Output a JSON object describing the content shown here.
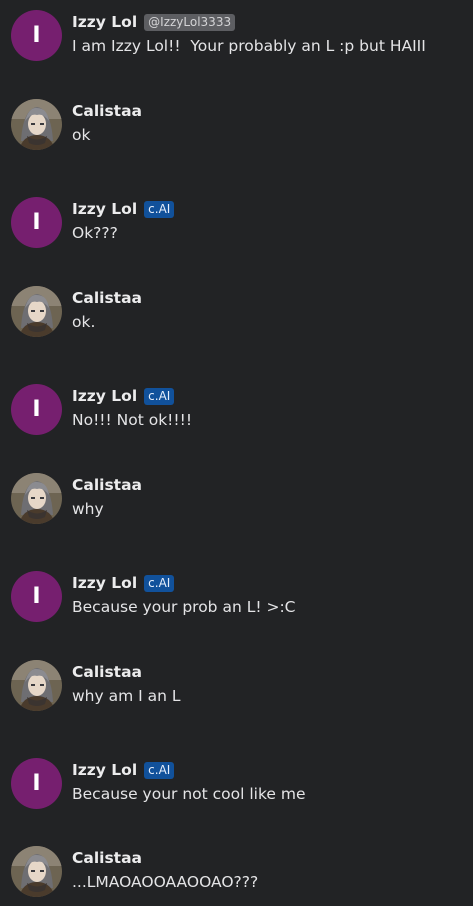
{
  "messages": [
    {
      "role": "bot",
      "avatar_letter": "I",
      "name": "Izzy Lol",
      "badge": "@IzzyLol3333",
      "badge_type": "handle",
      "text": "I am Izzy Lol!!  Your probably an L :p but HAIII"
    },
    {
      "role": "user",
      "avatar": "user-avatar",
      "name": "Calistaa",
      "text": "ok"
    },
    {
      "role": "bot",
      "avatar_letter": "I",
      "name": "Izzy Lol",
      "badge": "c.AI",
      "badge_type": "cai",
      "text": "Ok???"
    },
    {
      "role": "user",
      "avatar": "user-avatar",
      "name": "Calistaa",
      "text": "ok."
    },
    {
      "role": "bot",
      "avatar_letter": "I",
      "name": "Izzy Lol",
      "badge": "c.AI",
      "badge_type": "cai",
      "text": "No!!! Not ok!!!!"
    },
    {
      "role": "user",
      "avatar": "user-avatar",
      "name": "Calistaa",
      "text": "why"
    },
    {
      "role": "bot",
      "avatar_letter": "I",
      "name": "Izzy Lol",
      "badge": "c.AI",
      "badge_type": "cai",
      "text": "Because your prob an L! >:C"
    },
    {
      "role": "user",
      "avatar": "user-avatar",
      "name": "Calistaa",
      "text": "why am I an L"
    },
    {
      "role": "bot",
      "avatar_letter": "I",
      "name": "Izzy Lol",
      "badge": "c.AI",
      "badge_type": "cai",
      "text": "Because your not cool like me"
    },
    {
      "role": "user",
      "avatar": "user-avatar",
      "name": "Calistaa",
      "text": "...LMAOAOOAAOOAO???"
    }
  ],
  "colors": {
    "background": "#222325",
    "bot_avatar": "#761f6f",
    "cai_badge": "#11519b",
    "handle_badge": "#5d5e62"
  }
}
